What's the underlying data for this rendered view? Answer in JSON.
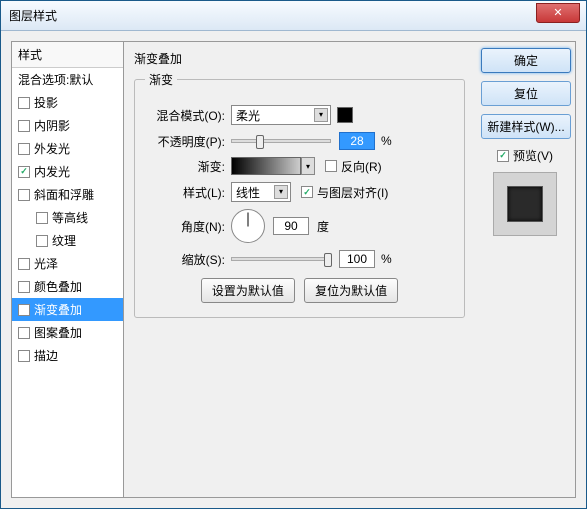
{
  "window": {
    "title": "图层样式",
    "close": "✕"
  },
  "styles": {
    "header": "样式",
    "blendDefault": "混合选项:默认",
    "items": [
      {
        "label": "投影",
        "checked": false,
        "indent": false
      },
      {
        "label": "内阴影",
        "checked": false,
        "indent": false
      },
      {
        "label": "外发光",
        "checked": false,
        "indent": false
      },
      {
        "label": "内发光",
        "checked": true,
        "indent": false
      },
      {
        "label": "斜面和浮雕",
        "checked": false,
        "indent": false
      },
      {
        "label": "等高线",
        "checked": false,
        "indent": true
      },
      {
        "label": "纹理",
        "checked": false,
        "indent": true
      },
      {
        "label": "光泽",
        "checked": false,
        "indent": false
      },
      {
        "label": "颜色叠加",
        "checked": false,
        "indent": false
      },
      {
        "label": "渐变叠加",
        "checked": true,
        "indent": false,
        "selected": true
      },
      {
        "label": "图案叠加",
        "checked": false,
        "indent": false
      },
      {
        "label": "描边",
        "checked": false,
        "indent": false
      }
    ]
  },
  "panel": {
    "title": "渐变叠加",
    "group": "渐变",
    "blendMode": {
      "label": "混合模式(O):",
      "value": "柔光"
    },
    "opacity": {
      "label": "不透明度(P):",
      "value": "28",
      "unit": "%"
    },
    "gradient": {
      "label": "渐变:",
      "reverse": "反向(R)"
    },
    "style": {
      "label": "样式(L):",
      "value": "线性",
      "align": "与图层对齐(I)",
      "alignChecked": true
    },
    "angle": {
      "label": "角度(N):",
      "value": "90",
      "unit": "度"
    },
    "scale": {
      "label": "缩放(S):",
      "value": "100",
      "unit": "%"
    },
    "setDefault": "设置为默认值",
    "resetDefault": "复位为默认值"
  },
  "right": {
    "ok": "确定",
    "cancel": "复位",
    "newStyle": "新建样式(W)...",
    "preview": "预览(V)"
  }
}
